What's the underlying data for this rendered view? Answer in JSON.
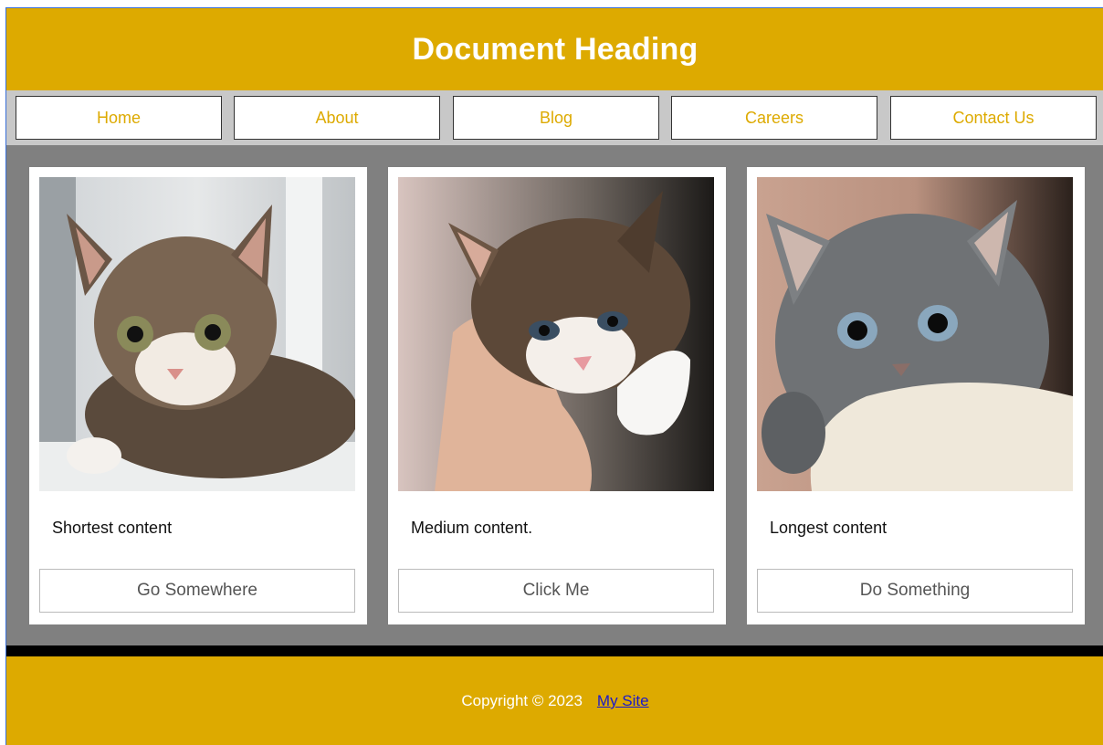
{
  "header": {
    "title": "Document Heading"
  },
  "nav": {
    "items": [
      "Home",
      "About",
      "Blog",
      "Careers",
      "Contact Us"
    ]
  },
  "cards": [
    {
      "image": "kitten-photo-1",
      "text": "Shortest content",
      "button": "Go Somewhere"
    },
    {
      "image": "kitten-photo-2",
      "text": "Medium content.",
      "button": "Click Me"
    },
    {
      "image": "kitten-photo-3",
      "text": "Longest content",
      "button": "Do Something"
    }
  ],
  "footer": {
    "copyright": "Copyright © 2023",
    "link": "My Site"
  },
  "colors": {
    "brand": "#ddaa00",
    "nav_bg": "#c8c8c8",
    "main_bg": "#808080",
    "link": "#1a1acc"
  }
}
